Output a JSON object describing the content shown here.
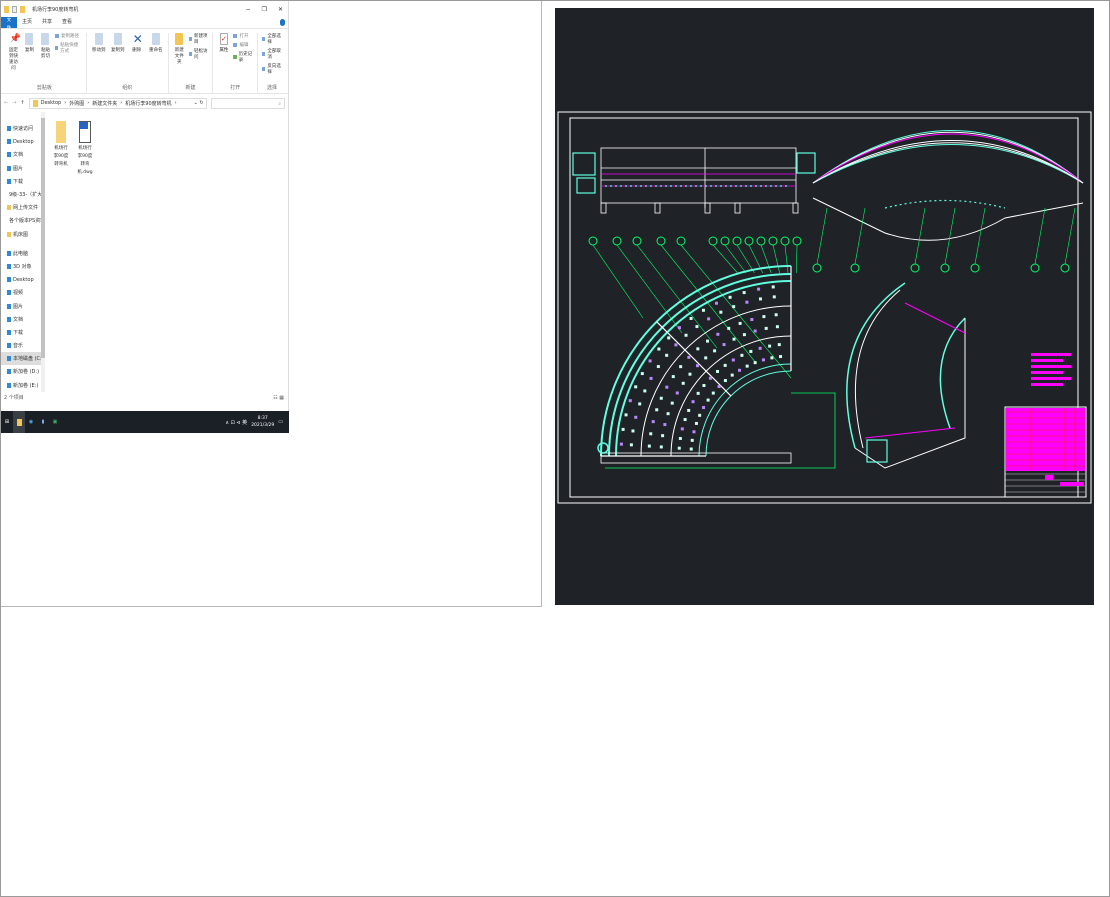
{
  "explorer": {
    "title": "机场行李90度转弯机",
    "window_buttons": [
      "−",
      "❐",
      "✕"
    ],
    "tabs": [
      "文件",
      "主页",
      "共享",
      "查看"
    ],
    "ribbon": {
      "clipboard": {
        "pin": "固定到快速访问",
        "copy": "复制",
        "paste": "粘贴",
        "copy_path": "复制路径",
        "paste_shortcut": "粘贴快捷方式",
        "cut": "剪切",
        "label": "剪贴板"
      },
      "organize": {
        "move_to": "移动到",
        "copy_to": "复制到",
        "delete": "删除",
        "rename": "重命名",
        "label": "组织"
      },
      "new": {
        "new_item": "新建项目",
        "easy_access": "轻松访问",
        "new_folder": "新建文件夹",
        "label": "新建"
      },
      "open": {
        "properties": "属性",
        "open": "打开",
        "edit": "编辑",
        "history": "历史记录",
        "label": "打开"
      },
      "select": {
        "select_all": "全部选择",
        "select_none": "全部取消",
        "invert": "反向选择",
        "label": "选择"
      }
    },
    "address": {
      "path": [
        "Desktop",
        "外购图",
        "新建文件夹",
        "机场行李90度转弯机"
      ],
      "search_icon": "search-icon"
    },
    "nav": {
      "quick_access": [
        "快速访问",
        "Desktop",
        "文档",
        "图片",
        "下载",
        "9级-33-（扩大）",
        "网上传文件",
        "各个版本PS资料",
        "机床图"
      ],
      "this_pc": [
        "此电脑",
        "3D 对象",
        "Desktop",
        "视频",
        "图片",
        "文档",
        "下载",
        "音乐",
        "本地磁盘 (C:)",
        "新加卷 (D:)",
        "新加卷 (E:)"
      ],
      "selected": "本地磁盘 (C:)"
    },
    "files": [
      {
        "name": "机场行李90度转弯机",
        "type": "folder"
      },
      {
        "name": "机场行李90度转弯机.dwg",
        "type": "dwg"
      }
    ],
    "status": "2 个项目"
  },
  "taskbar": {
    "time": "8:37",
    "date": "2021/3/29",
    "tray": "∧ ⊡ ⊲ 英"
  },
  "cad": {
    "background": "#1f2227",
    "line_colors": [
      "#ffffff",
      "#00ff66",
      "#5fffe0",
      "#ff00ff",
      "#ff2020"
    ]
  }
}
